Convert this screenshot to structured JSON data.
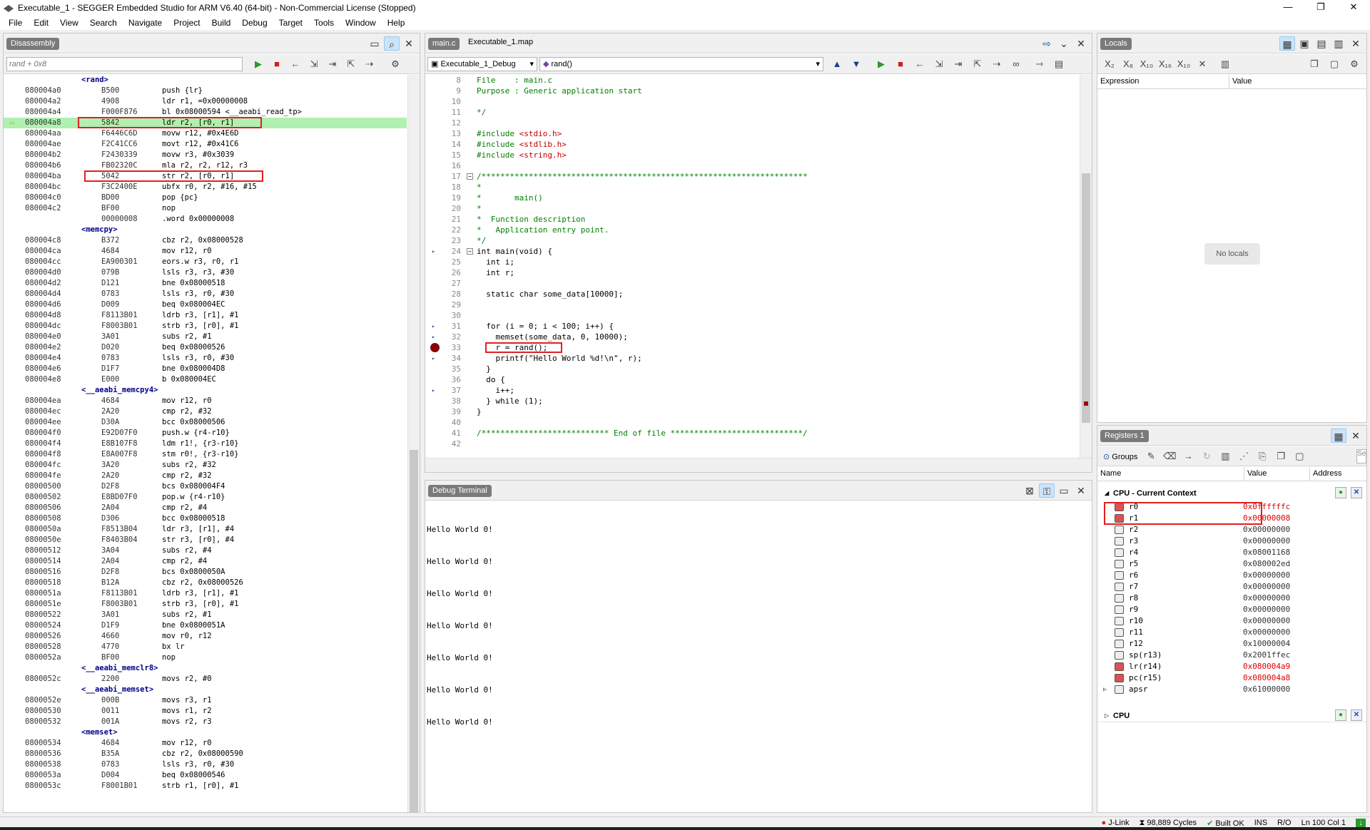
{
  "window": {
    "title": "Executable_1 - SEGGER Embedded Studio for ARM V6.40 (64-bit) - Non-Commercial License (Stopped)",
    "controls": [
      "—",
      "❐",
      "✕"
    ]
  },
  "menu": [
    "File",
    "Edit",
    "View",
    "Search",
    "Navigate",
    "Project",
    "Build",
    "Debug",
    "Target",
    "Tools",
    "Window",
    "Help"
  ],
  "disassembly": {
    "title": "Disassembly",
    "input_placeholder": "rand + 0x8",
    "rows": [
      {
        "label": "<rand>"
      },
      {
        "addr": "080004a0",
        "op": "B500",
        "ins": "push {lr}"
      },
      {
        "addr": "080004a2",
        "op": "4908",
        "ins": "ldr r1, =0x00000008"
      },
      {
        "addr": "080004a4",
        "op": "F000F876",
        "ins": "bl 0x08000594 <__aeabi_read_tp>"
      },
      {
        "addr": "080004a8",
        "op": "5842",
        "ins": "ldr r2, [r0, r1]",
        "current": true
      },
      {
        "addr": "080004aa",
        "op": "F6446C6D",
        "ins": "movw r12, #0x4E6D"
      },
      {
        "addr": "080004ae",
        "op": "F2C41CC6",
        "ins": "movt r12, #0x41C6"
      },
      {
        "addr": "080004b2",
        "op": "F2430339",
        "ins": "movw r3, #0x3039"
      },
      {
        "addr": "080004b6",
        "op": "FB02320C",
        "ins": "mla r2, r2, r12, r3"
      },
      {
        "addr": "080004ba",
        "op": "5042",
        "ins": "str r2, [r0, r1]"
      },
      {
        "addr": "080004bc",
        "op": "F3C2400E",
        "ins": "ubfx r0, r2, #16, #15"
      },
      {
        "addr": "080004c0",
        "op": "BD00",
        "ins": "pop {pc}"
      },
      {
        "addr": "080004c2",
        "op": "BF00",
        "ins": "nop"
      },
      {
        "addr": "",
        "op": "00000008",
        "ins": ".word 0x00000008"
      },
      {
        "label": "<memcpy>"
      },
      {
        "addr": "080004c8",
        "op": "B372",
        "ins": "cbz r2, 0x08000528"
      },
      {
        "addr": "080004ca",
        "op": "4684",
        "ins": "mov r12, r0"
      },
      {
        "addr": "080004cc",
        "op": "EA900301",
        "ins": "eors.w r3, r0, r1"
      },
      {
        "addr": "080004d0",
        "op": "079B",
        "ins": "lsls r3, r3, #30"
      },
      {
        "addr": "080004d2",
        "op": "D121",
        "ins": "bne 0x08000518"
      },
      {
        "addr": "080004d4",
        "op": "0783",
        "ins": "lsls r3, r0, #30"
      },
      {
        "addr": "080004d6",
        "op": "D009",
        "ins": "beq 0x080004EC"
      },
      {
        "addr": "080004d8",
        "op": "F8113B01",
        "ins": "ldrb r3, [r1], #1"
      },
      {
        "addr": "080004dc",
        "op": "F8003B01",
        "ins": "strb r3, [r0], #1"
      },
      {
        "addr": "080004e0",
        "op": "3A01",
        "ins": "subs r2, #1"
      },
      {
        "addr": "080004e2",
        "op": "D020",
        "ins": "beq 0x08000526"
      },
      {
        "addr": "080004e4",
        "op": "0783",
        "ins": "lsls r3, r0, #30"
      },
      {
        "addr": "080004e6",
        "op": "D1F7",
        "ins": "bne 0x080004D8"
      },
      {
        "addr": "080004e8",
        "op": "E000",
        "ins": "b 0x080004EC"
      },
      {
        "label": "<__aeabi_memcpy4>"
      },
      {
        "addr": "080004ea",
        "op": "4684",
        "ins": "mov r12, r0"
      },
      {
        "addr": "080004ec",
        "op": "2A20",
        "ins": "cmp r2, #32"
      },
      {
        "addr": "080004ee",
        "op": "D30A",
        "ins": "bcc 0x08000506"
      },
      {
        "addr": "080004f0",
        "op": "E92D07F0",
        "ins": "push.w {r4-r10}"
      },
      {
        "addr": "080004f4",
        "op": "E8B107F8",
        "ins": "ldm r1!, {r3-r10}"
      },
      {
        "addr": "080004f8",
        "op": "E8A007F8",
        "ins": "stm r0!, {r3-r10}"
      },
      {
        "addr": "080004fc",
        "op": "3A20",
        "ins": "subs r2, #32"
      },
      {
        "addr": "080004fe",
        "op": "2A20",
        "ins": "cmp r2, #32"
      },
      {
        "addr": "08000500",
        "op": "D2F8",
        "ins": "bcs 0x080004F4"
      },
      {
        "addr": "08000502",
        "op": "E8BD07F0",
        "ins": "pop.w {r4-r10}"
      },
      {
        "addr": "08000506",
        "op": "2A04",
        "ins": "cmp r2, #4"
      },
      {
        "addr": "08000508",
        "op": "D306",
        "ins": "bcc 0x08000518"
      },
      {
        "addr": "0800050a",
        "op": "F8513B04",
        "ins": "ldr r3, [r1], #4"
      },
      {
        "addr": "0800050e",
        "op": "F8403B04",
        "ins": "str r3, [r0], #4"
      },
      {
        "addr": "08000512",
        "op": "3A04",
        "ins": "subs r2, #4"
      },
      {
        "addr": "08000514",
        "op": "2A04",
        "ins": "cmp r2, #4"
      },
      {
        "addr": "08000516",
        "op": "D2F8",
        "ins": "bcs 0x0800050A"
      },
      {
        "addr": "08000518",
        "op": "B12A",
        "ins": "cbz r2, 0x08000526"
      },
      {
        "addr": "0800051a",
        "op": "F8113B01",
        "ins": "ldrb r3, [r1], #1"
      },
      {
        "addr": "0800051e",
        "op": "F8003B01",
        "ins": "strb r3, [r0], #1"
      },
      {
        "addr": "08000522",
        "op": "3A01",
        "ins": "subs r2, #1"
      },
      {
        "addr": "08000524",
        "op": "D1F9",
        "ins": "bne 0x0800051A"
      },
      {
        "addr": "08000526",
        "op": "4660",
        "ins": "mov r0, r12"
      },
      {
        "addr": "08000528",
        "op": "4770",
        "ins": "bx lr"
      },
      {
        "addr": "0800052a",
        "op": "BF00",
        "ins": "nop"
      },
      {
        "label": "<__aeabi_memclr8>"
      },
      {
        "addr": "0800052c",
        "op": "2200",
        "ins": "movs r2, #0"
      },
      {
        "label": "<__aeabi_memset>"
      },
      {
        "addr": "0800052e",
        "op": "000B",
        "ins": "movs r3, r1"
      },
      {
        "addr": "08000530",
        "op": "0011",
        "ins": "movs r1, r2"
      },
      {
        "addr": "08000532",
        "op": "001A",
        "ins": "movs r2, r3"
      },
      {
        "label": "<memset>"
      },
      {
        "addr": "08000534",
        "op": "4684",
        "ins": "mov r12, r0"
      },
      {
        "addr": "08000536",
        "op": "B35A",
        "ins": "cbz r2, 0x08000590"
      },
      {
        "addr": "08000538",
        "op": "0783",
        "ins": "lsls r3, r0, #30"
      },
      {
        "addr": "0800053a",
        "op": "D004",
        "ins": "beq 0x08000546"
      },
      {
        "addr": "0800053c",
        "op": "F8001B01",
        "ins": "strb r1, [r0], #1"
      }
    ]
  },
  "editor": {
    "tabs": [
      "main.c",
      "Executable_1.map"
    ],
    "config": "Executable_1_Debug",
    "function": "rand()",
    "lines": [
      {
        "n": "8",
        "code": "File    : main.c",
        "kind": "com"
      },
      {
        "n": "9",
        "code": "Purpose : Generic application start",
        "kind": "com"
      },
      {
        "n": "10",
        "code": "",
        "kind": "com"
      },
      {
        "n": "11",
        "code": "*/",
        "kind": "com"
      },
      {
        "n": "12",
        "code": "",
        "kind": "plain"
      },
      {
        "n": "13",
        "code": "#include <stdio.h>",
        "kind": "inc",
        "pre": "#include ",
        "post": "<stdio.h>"
      },
      {
        "n": "14",
        "code": "#include <stdlib.h>",
        "kind": "inc",
        "pre": "#include ",
        "post": "<stdlib.h>"
      },
      {
        "n": "15",
        "code": "#include <string.h>",
        "kind": "inc",
        "pre": "#include ",
        "post": "<string.h>"
      },
      {
        "n": "16",
        "code": "",
        "kind": "plain"
      },
      {
        "n": "17",
        "code": "/*********************************************************************",
        "kind": "com"
      },
      {
        "n": "18",
        "code": "*",
        "kind": "com"
      },
      {
        "n": "19",
        "code": "*       main()",
        "kind": "com"
      },
      {
        "n": "20",
        "code": "*",
        "kind": "com"
      },
      {
        "n": "21",
        "code": "*  Function description",
        "kind": "com"
      },
      {
        "n": "22",
        "code": "*   Application entry point.",
        "kind": "com"
      },
      {
        "n": "23",
        "code": "*/",
        "kind": "com"
      },
      {
        "n": "24",
        "code": "int main(void) {",
        "kind": "plain"
      },
      {
        "n": "25",
        "code": "  int i;",
        "kind": "plain"
      },
      {
        "n": "26",
        "code": "  int r;",
        "kind": "plain"
      },
      {
        "n": "27",
        "code": "",
        "kind": "plain"
      },
      {
        "n": "28",
        "code": "  static char some_data[10000];",
        "kind": "plain"
      },
      {
        "n": "29",
        "code": "",
        "kind": "plain"
      },
      {
        "n": "30",
        "code": "",
        "kind": "plain"
      },
      {
        "n": "31",
        "code": "  for (i = 0; i < 100; i++) {",
        "kind": "plain"
      },
      {
        "n": "32",
        "code": "    memset(some_data, 0, 10000);",
        "kind": "plain"
      },
      {
        "n": "33",
        "code": "    r = rand();",
        "kind": "plain"
      },
      {
        "n": "34",
        "code": "    printf(\"Hello World %d!\\n\", r);",
        "kind": "plain"
      },
      {
        "n": "35",
        "code": "  }",
        "kind": "plain"
      },
      {
        "n": "36",
        "code": "  do {",
        "kind": "plain"
      },
      {
        "n": "37",
        "code": "    i++;",
        "kind": "plain"
      },
      {
        "n": "38",
        "code": "  } while (1);",
        "kind": "plain"
      },
      {
        "n": "39",
        "code": "}",
        "kind": "plain"
      },
      {
        "n": "40",
        "code": "",
        "kind": "plain"
      },
      {
        "n": "41",
        "code": "/*************************** End of file ****************************/",
        "kind": "com"
      },
      {
        "n": "42",
        "code": "",
        "kind": "plain"
      }
    ]
  },
  "terminal": {
    "title": "Debug Terminal",
    "lines": [
      "Hello World 0!",
      "Hello World 0!",
      "Hello World 0!",
      "Hello World 0!",
      "Hello World 0!",
      "Hello World 0!",
      "Hello World 0!"
    ]
  },
  "locals": {
    "title": "Locals",
    "col_expression": "Expression",
    "col_value": "Value",
    "empty": "No locals"
  },
  "registers": {
    "title": "Registers 1",
    "groups_label": "Groups",
    "col_name": "Name",
    "col_value": "Value",
    "col_address": "Address",
    "group_current": "CPU - Current Context",
    "group_cpu": "CPU",
    "rows": [
      {
        "name": "r0",
        "value": "0x0ffffffc",
        "changed": true
      },
      {
        "name": "r1",
        "value": "0x00000008",
        "changed": true
      },
      {
        "name": "r2",
        "value": "0x00000000",
        "changed": false
      },
      {
        "name": "r3",
        "value": "0x00000000",
        "changed": false
      },
      {
        "name": "r4",
        "value": "0x08001168",
        "changed": false
      },
      {
        "name": "r5",
        "value": "0x080002ed",
        "changed": false
      },
      {
        "name": "r6",
        "value": "0x00000000",
        "changed": false
      },
      {
        "name": "r7",
        "value": "0x00000000",
        "changed": false
      },
      {
        "name": "r8",
        "value": "0x00000000",
        "changed": false
      },
      {
        "name": "r9",
        "value": "0x00000000",
        "changed": false
      },
      {
        "name": "r10",
        "value": "0x00000000",
        "changed": false
      },
      {
        "name": "r11",
        "value": "0x00000000",
        "changed": false
      },
      {
        "name": "r12",
        "value": "0x10000004",
        "changed": false
      },
      {
        "name": "sp(r13)",
        "value": "0x2001ffec",
        "changed": false
      },
      {
        "name": "lr(r14)",
        "value": "0x080004a9",
        "changed": true
      },
      {
        "name": "pc(r15)",
        "value": "0x080004a8",
        "changed": true
      },
      {
        "name": "apsr",
        "value": "0x61000000",
        "changed": false
      }
    ]
  },
  "status": {
    "jlink": "J-Link",
    "cycles": "98,889 Cycles",
    "build": "Built OK",
    "ins": "INS",
    "ro": "R/O",
    "pos": "Ln 100 Col 1"
  },
  "colors": {
    "changed": "#e00000",
    "current_line": "#b0f0b0",
    "pill": "#7a7a7a"
  }
}
